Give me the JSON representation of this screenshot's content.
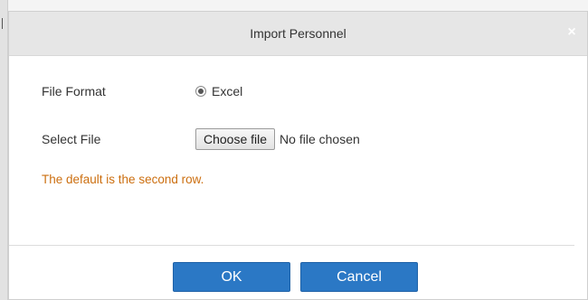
{
  "dialog": {
    "title": "Import Personnel",
    "close_glyph": "×"
  },
  "form": {
    "file_format_label": "File Format",
    "file_format_option": "Excel",
    "file_format_selected": true,
    "select_file_label": "Select File",
    "choose_file_button": "Choose file",
    "file_status": "No file chosen"
  },
  "note": "The default is the second row.",
  "buttons": {
    "ok": "OK",
    "cancel": "Cancel"
  },
  "colors": {
    "accent": "#2b78c5",
    "note": "#cc6f10",
    "titlebar": "#e6e6e6"
  }
}
